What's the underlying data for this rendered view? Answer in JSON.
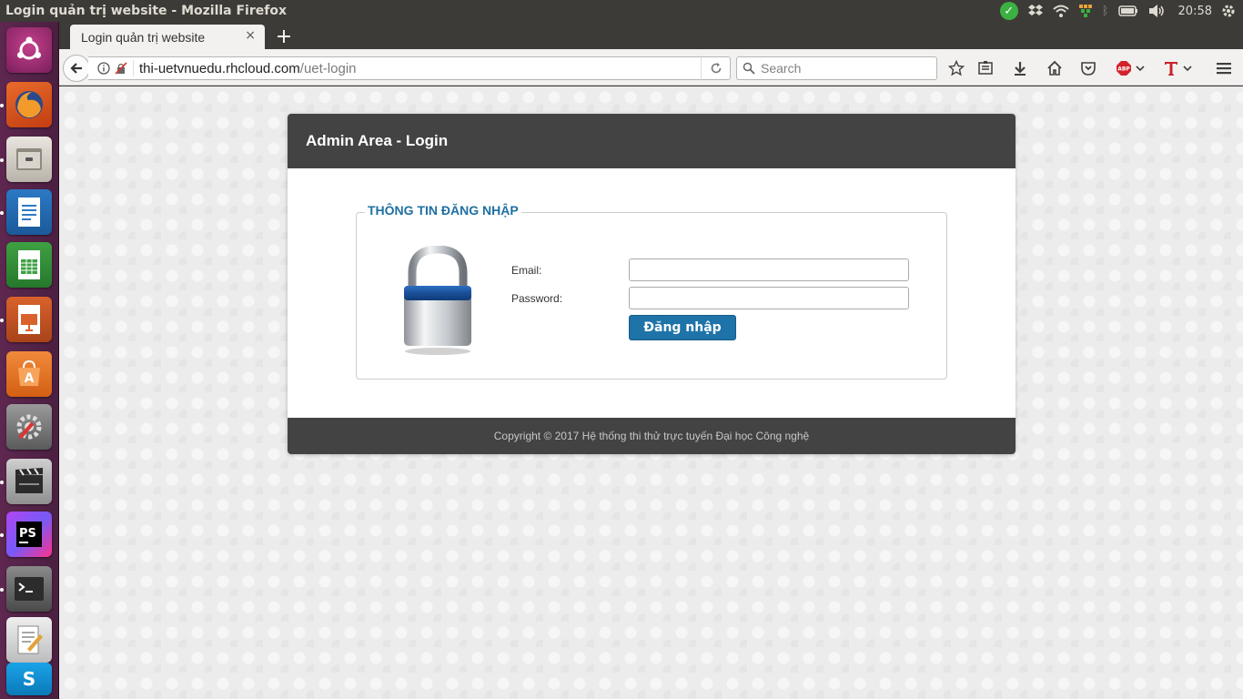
{
  "os": {
    "window_title": "Login quản trị website - Mozilla Firefox",
    "clock": "20:58"
  },
  "browser": {
    "tab_title": "Login quản trị website",
    "tab_close": "×",
    "new_tab": "+",
    "url_host": "thi-uetvnuedu.rhcloud.com",
    "url_path": "/uet-login",
    "search_placeholder": "Search"
  },
  "page": {
    "panel_title": "Admin Area - Login",
    "legend": "THÔNG TIN ĐĂNG NHẬP",
    "email_label": "Email:",
    "email_value": "",
    "password_label": "Password:",
    "password_value": "",
    "login_button": "Đăng nhập",
    "footer": "Copyright © 2017 Hệ thống thi thử trực tuyến Đại học Công nghệ"
  },
  "launcher": {
    "items": [
      {
        "name": "ubuntu-dash-icon"
      },
      {
        "name": "firefox-icon"
      },
      {
        "name": "files-icon"
      },
      {
        "name": "writer-icon"
      },
      {
        "name": "calc-icon"
      },
      {
        "name": "impress-icon"
      },
      {
        "name": "software-center-icon"
      },
      {
        "name": "system-settings-icon"
      },
      {
        "name": "video-editor-icon"
      },
      {
        "name": "phpstorm-icon"
      },
      {
        "name": "terminal-icon"
      },
      {
        "name": "text-editor-icon"
      },
      {
        "name": "skype-icon"
      }
    ]
  },
  "colors": {
    "launcher_bg": "#5e2750",
    "panel_header": "#434343",
    "legend": "#1f6fa3",
    "login_button": "#1e73a8"
  }
}
